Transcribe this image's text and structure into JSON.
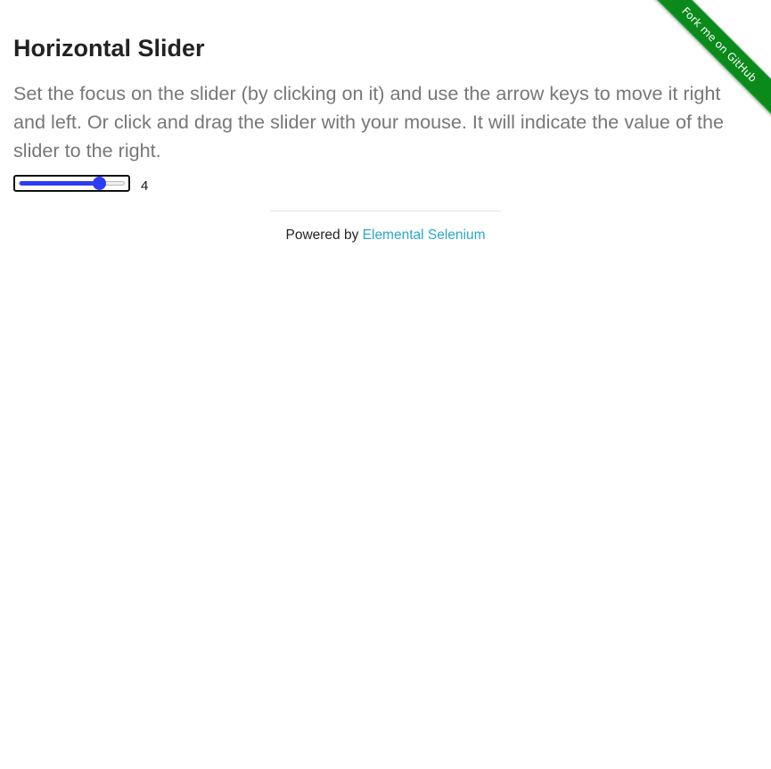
{
  "page": {
    "title": "Horizontal Slider",
    "description": "Set the focus on the slider (by clicking on it) and use the arrow keys to move it right and left. Or click and drag the slider with your mouse. It will indicate the value of the slider to the right."
  },
  "slider": {
    "min": 0,
    "max": 5,
    "value": 4,
    "display_value": "4",
    "accent_color": "#2f3cf5"
  },
  "footer": {
    "prefix": "Powered by ",
    "link_label": "Elemental Selenium",
    "link_color": "#2ba6cb"
  },
  "ribbon": {
    "label": "Fork me on GitHub",
    "color": "#0a8a1a"
  }
}
